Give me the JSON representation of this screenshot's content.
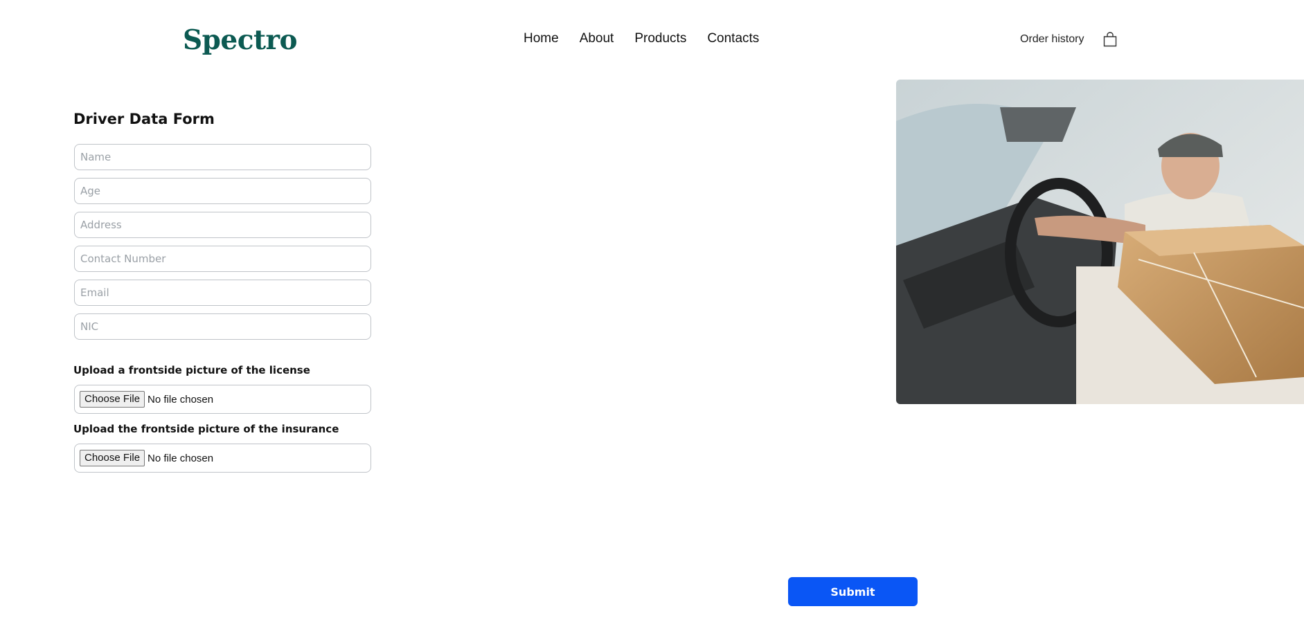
{
  "header": {
    "logo": "Spectro",
    "nav": [
      "Home",
      "About",
      "Products",
      "Contacts"
    ],
    "order_history": "Order history",
    "cart_icon": "shopping-bag-icon"
  },
  "form": {
    "title": "Driver Data Form",
    "fields": {
      "name": "Name",
      "age": "Age",
      "address": "Address",
      "contact": "Contact Number",
      "email": "Email",
      "nic": "NIC"
    },
    "uploads": [
      {
        "label": "Upload a frontside picture of the license",
        "button": "Choose File",
        "status": "No file chosen"
      },
      {
        "label": "Upload the frontside picture of the insurance",
        "button": "Choose File",
        "status": "No file chosen"
      }
    ],
    "submit": "Submit"
  },
  "colors": {
    "brand": "#0c5a52",
    "primary": "#0a56f5"
  }
}
